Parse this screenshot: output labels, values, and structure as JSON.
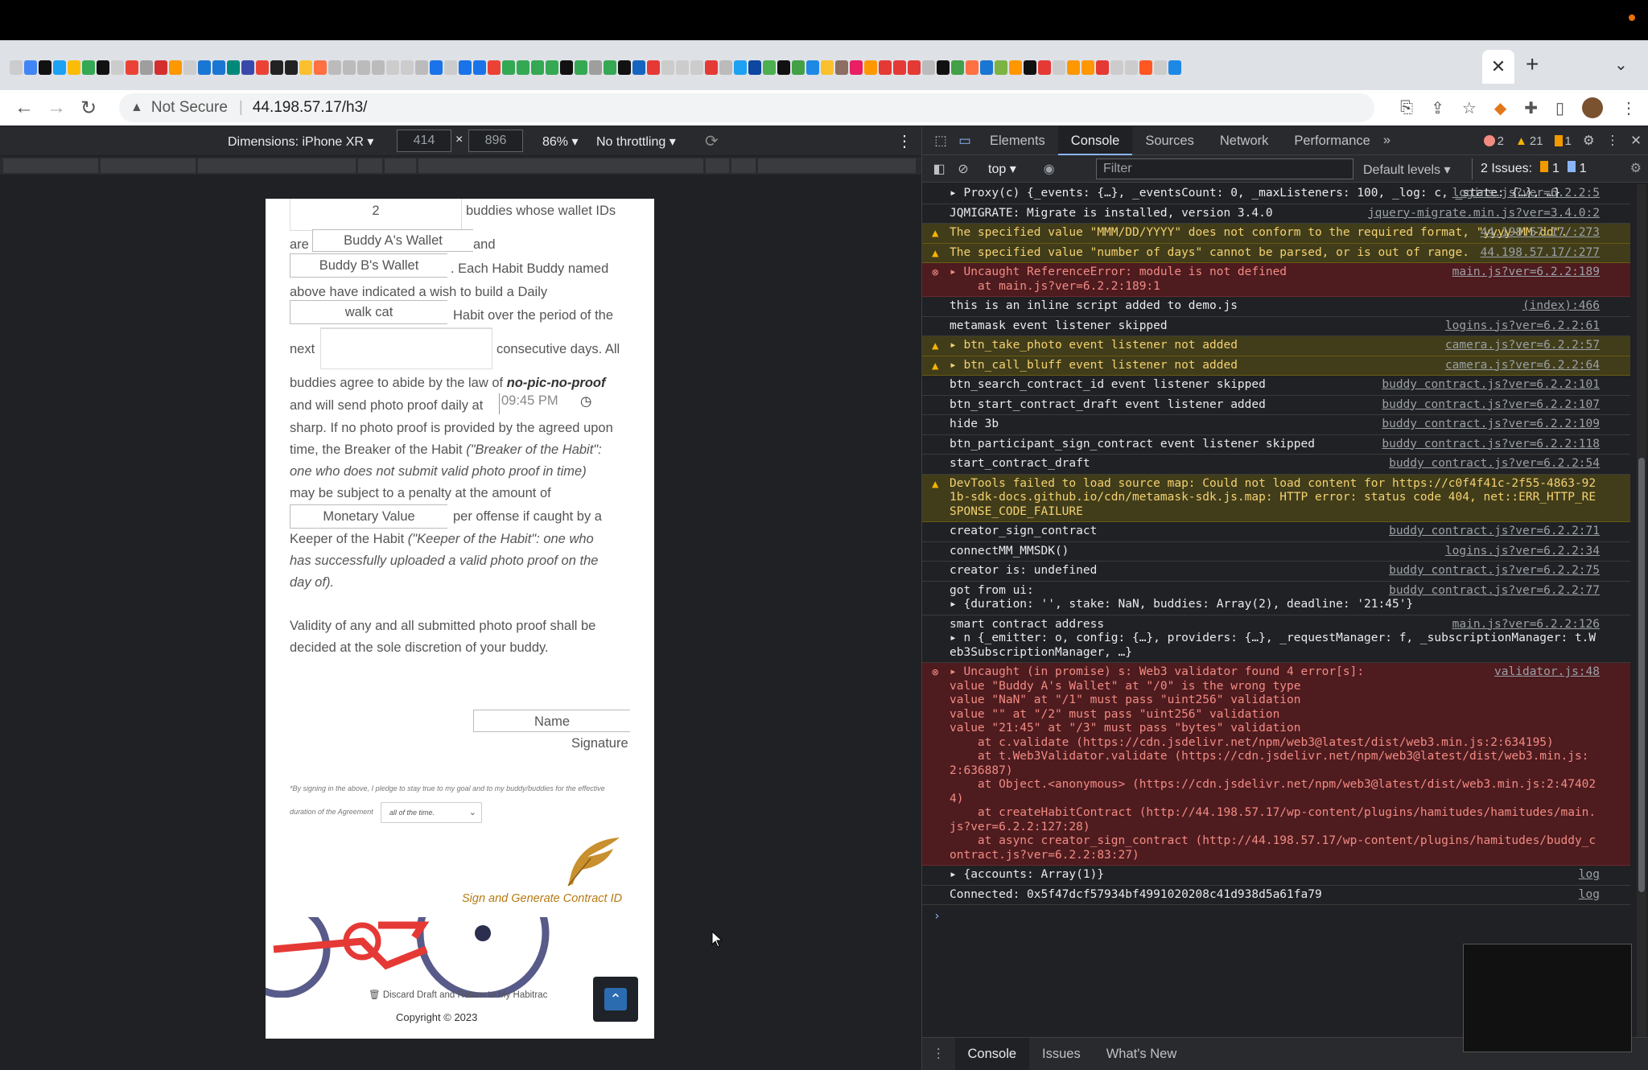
{
  "browser": {
    "tab_close": "✕",
    "tab_new": "+",
    "address": {
      "security_label": "Not Secure",
      "url": "44.198.57.17/h3/"
    }
  },
  "device_toolbar": {
    "dimensions_label": "Dimensions: iPhone XR ▾",
    "width": "414",
    "height": "896",
    "times": "×",
    "zoom": "86% ▾",
    "throttling": "No throttling ▾"
  },
  "page": {
    "count_field": "2",
    "t_buddies": "buddies whose wallet IDs",
    "t_are": "are",
    "buddy_a_placeholder": "Buddy A's Wallet",
    "t_and": "and",
    "buddy_b_placeholder": "Buddy B's Wallet",
    "t_each": ". Each Habit Buddy named",
    "t_above": "above have indicated a wish to build a Daily",
    "habit_field": "walk cat",
    "t_habit": "Habit over the period of the",
    "t_next": "next",
    "t_consecutive": "consecutive days. All",
    "t_buddies_agree": "buddies agree to abide by the law of",
    "law_name": "no-pic-no-proof",
    "t_send": "and will send photo proof daily at",
    "time_value": "09:45 PM",
    "t_sharp": "sharp. If no photo proof is provided by the agreed upon",
    "t_time_breaker": "time, the Breaker of the Habit",
    "t_breaker_def1": "(\"Breaker of the Habit\":",
    "t_breaker_def2": "one who does not submit valid photo proof in time)",
    "t_penalty": "may be subject to a penalty at the amount of",
    "monetary_placeholder": "Monetary Value",
    "t_per_offense": "per offense if caught by a",
    "t_keeper": "Keeper of the Habit",
    "t_keeper_def1": "(\"Keeper of the Habit\": one who",
    "t_keeper_def2": "has successfully uploaded a valid photo proof on the",
    "t_keeper_def3": "day of).",
    "t_validity1": "Validity of any and all submitted photo proof shall be",
    "t_validity2": "decided at the sole discretion of your buddy.",
    "name_placeholder": "Name",
    "signature_label": "Signature",
    "pledge_text": "*By signing in the above, I pledge to stay true to my goal and to my buddy/buddies for the effective",
    "duration_text": "duration of the Agreement",
    "duration_select": "all of the time.",
    "sign_button": "Sign and Generate Contract ID",
    "discard_link": "Discard Draft and Return to My Habitrac",
    "copyright": "Copyright © 2023"
  },
  "devtools": {
    "tabs": [
      "Elements",
      "Console",
      "Sources",
      "Network",
      "Performance"
    ],
    "errors": "2",
    "warnings": "21",
    "issues_count": "1",
    "context": "top ▾",
    "filter_placeholder": "Filter",
    "levels": "Default levels ▾",
    "issues_label": "2 Issues:",
    "issues_warn": "1",
    "issues_info": "1",
    "drawer_tabs": [
      "Console",
      "Issues",
      "What's New"
    ]
  },
  "console": [
    {
      "level": "log",
      "text": "▸ Proxy(c) {_events: {…}, _eventsCount: 0, _maxListeners: 100, _log: c, _state: {…}, …}",
      "source": "logins.js?ver=6.2.2:5"
    },
    {
      "level": "log",
      "text": "JQMIGRATE: Migrate is installed, version 3.4.0",
      "source": "jquery-migrate.min.js?ver=3.4.0:2"
    },
    {
      "level": "warn",
      "text": "The specified value \"MMM/DD/YYYY\" does not conform to the required format, \"yyyy-MM-dd\".",
      "source": "44.198.57.17/:273"
    },
    {
      "level": "warn",
      "text": "The specified value \"number of days\" cannot be parsed, or is out of range.",
      "source": "44.198.57.17/:277"
    },
    {
      "level": "error",
      "text": "▸ Uncaught ReferenceError: module is not defined\n    at main.js?ver=6.2.2:189:1",
      "source": "main.js?ver=6.2.2:189"
    },
    {
      "level": "log",
      "text": "this is an inline script added to demo.js",
      "source": "(index):466"
    },
    {
      "level": "log",
      "text": "metamask event listener skipped",
      "source": "logins.js?ver=6.2.2:61"
    },
    {
      "level": "warn",
      "text": "▸ btn_take_photo event listener not added",
      "source": "camera.js?ver=6.2.2:57"
    },
    {
      "level": "warn",
      "text": "▸ btn_call_bluff event listener not added",
      "source": "camera.js?ver=6.2.2:64"
    },
    {
      "level": "log",
      "text": "btn_search_contract_id event listener skipped",
      "source": "buddy contract.js?ver=6.2.2:101"
    },
    {
      "level": "log",
      "text": "btn_start_contract_draft event listener added",
      "source": "buddy contract.js?ver=6.2.2:107"
    },
    {
      "level": "log",
      "text": "hide 3b",
      "source": "buddy contract.js?ver=6.2.2:109"
    },
    {
      "level": "log",
      "text": "btn_participant_sign_contract event listener skipped",
      "source": "buddy contract.js?ver=6.2.2:118"
    },
    {
      "level": "log",
      "text": "start_contract_draft",
      "source": "buddy contract.js?ver=6.2.2:54"
    },
    {
      "level": "warn",
      "text": "DevTools failed to load source map: Could not load content for https://c0f4f41c-2f55-4863-921b-sdk-docs.github.io/cdn/metamask-sdk.js.map: HTTP error: status code 404, net::ERR_HTTP_RESPONSE_CODE_FAILURE",
      "source": ""
    },
    {
      "level": "log",
      "text": "creator_sign_contract",
      "source": "buddy contract.js?ver=6.2.2:71"
    },
    {
      "level": "log",
      "text": "connectMM_MMSDK()",
      "source": "logins.js?ver=6.2.2:34"
    },
    {
      "level": "log",
      "text": "creator is: undefined",
      "source": "buddy contract.js?ver=6.2.2:75"
    },
    {
      "level": "log",
      "text": "got from ui:\n▸ {duration: '', stake: NaN, buddies: Array(2), deadline: '21:45'}",
      "source": "buddy contract.js?ver=6.2.2:77"
    },
    {
      "level": "log",
      "text": "smart contract address\n▸ n {_emitter: o, config: {…}, providers: {…}, _requestManager: f, _subscriptionManager: t.Web3SubscriptionManager, …}",
      "source": "main.js?ver=6.2.2:126"
    },
    {
      "level": "error",
      "text": "▸ Uncaught (in promise) s: Web3 validator found 4 error[s]:\nvalue \"Buddy A's Wallet\" at \"/0\" is the wrong type\nvalue \"NaN\" at \"/1\" must pass \"uint256\" validation\nvalue \"\" at \"/2\" must pass \"uint256\" validation\nvalue \"21:45\" at \"/3\" must pass \"bytes\" validation\n    at c.validate (https://cdn.jsdelivr.net/npm/web3@latest/dist/web3.min.js:2:634195)\n    at t.Web3Validator.validate (https://cdn.jsdelivr.net/npm/web3@latest/dist/web3.min.js:2:636887)\n    at Object.<anonymous> (https://cdn.jsdelivr.net/npm/web3@latest/dist/web3.min.js:2:474024)\n    at createHabitContract (http://44.198.57.17/wp-content/plugins/hamitudes/hamitudes/main.js?ver=6.2.2:127:28)\n    at async creator_sign_contract (http://44.198.57.17/wp-content/plugins/hamitudes/buddy_contract.js?ver=6.2.2:83:27)",
      "source": "validator.js:48"
    },
    {
      "level": "log",
      "text": "▸ {accounts: Array(1)}",
      "source": "log"
    },
    {
      "level": "log",
      "text": "Connected: 0x5f47dcf57934bf4991020208c41d938d5a61fa79",
      "source": "log"
    }
  ],
  "colors": {
    "accent": "#8ab4f8",
    "warn_bg": "#413d1a",
    "err_bg": "#4e1b1f",
    "sign_link": "#b77a12"
  }
}
